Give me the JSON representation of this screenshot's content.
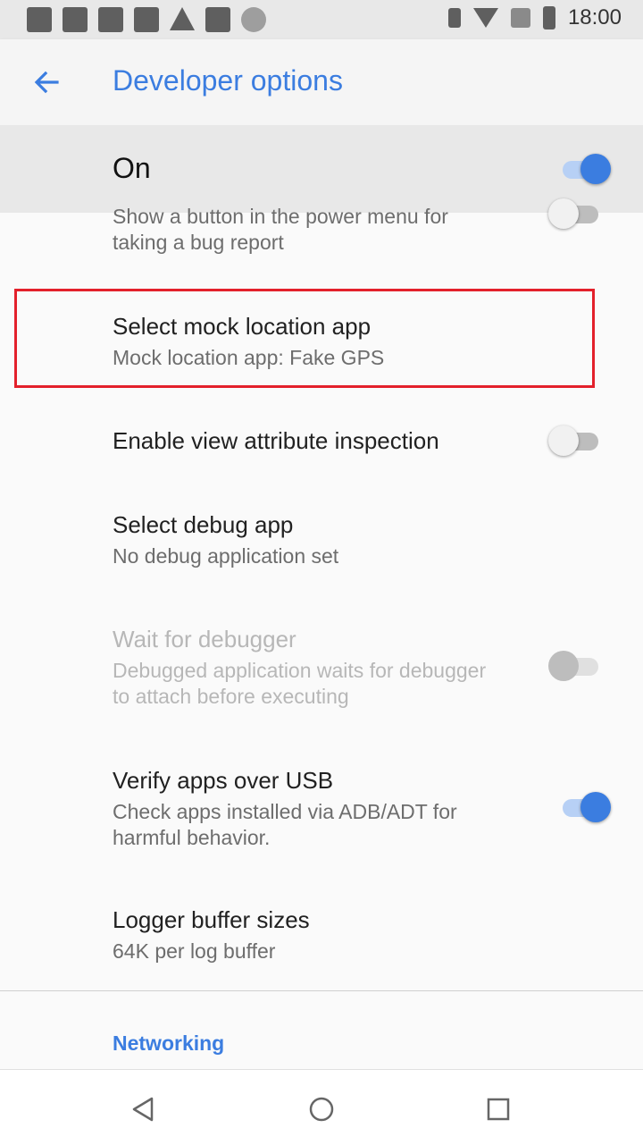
{
  "status_bar": {
    "time": "18:00",
    "left_icons": [
      "gallery-icon",
      "gmail-icon",
      "gmail-icon",
      "image-icon",
      "warning-icon",
      "fake-gps-icon",
      "sync-icon"
    ],
    "right_icons": [
      "bluetooth-icon",
      "wifi-icon",
      "no-sim-icon",
      "battery-icon"
    ]
  },
  "app_bar": {
    "title": "Developer options",
    "back_icon": "arrow-left-icon"
  },
  "master_switch": {
    "label": "On",
    "checked": true
  },
  "items": [
    {
      "summary_line1": "Show a button in the power menu for",
      "summary_line2": "taking a bug report",
      "switch": "off"
    },
    {
      "title": "Select mock location app",
      "summary": "Mock location app: Fake GPS"
    },
    {
      "title": "Enable view attribute inspection",
      "switch": "off"
    },
    {
      "title": "Select debug app",
      "summary": "No debug application set"
    },
    {
      "title": "Wait for debugger",
      "summary_line1": "Debugged application waits for debugger",
      "summary_line2": "to attach before executing",
      "switch": "disabled"
    },
    {
      "title": "Verify apps over USB",
      "summary_line1": "Check apps installed via ADB/ADT for",
      "summary_line2": "harmful behavior.",
      "switch": "on"
    },
    {
      "title": "Logger buffer sizes",
      "summary": "64K per log buffer"
    }
  ],
  "category": {
    "label": "Networking"
  },
  "nav_bar": {
    "back": "triangle-back-icon",
    "home": "circle-home-icon",
    "recents": "square-recents-icon"
  },
  "colors": {
    "accent": "#3b7de0",
    "highlight_border": "#e3202b"
  }
}
